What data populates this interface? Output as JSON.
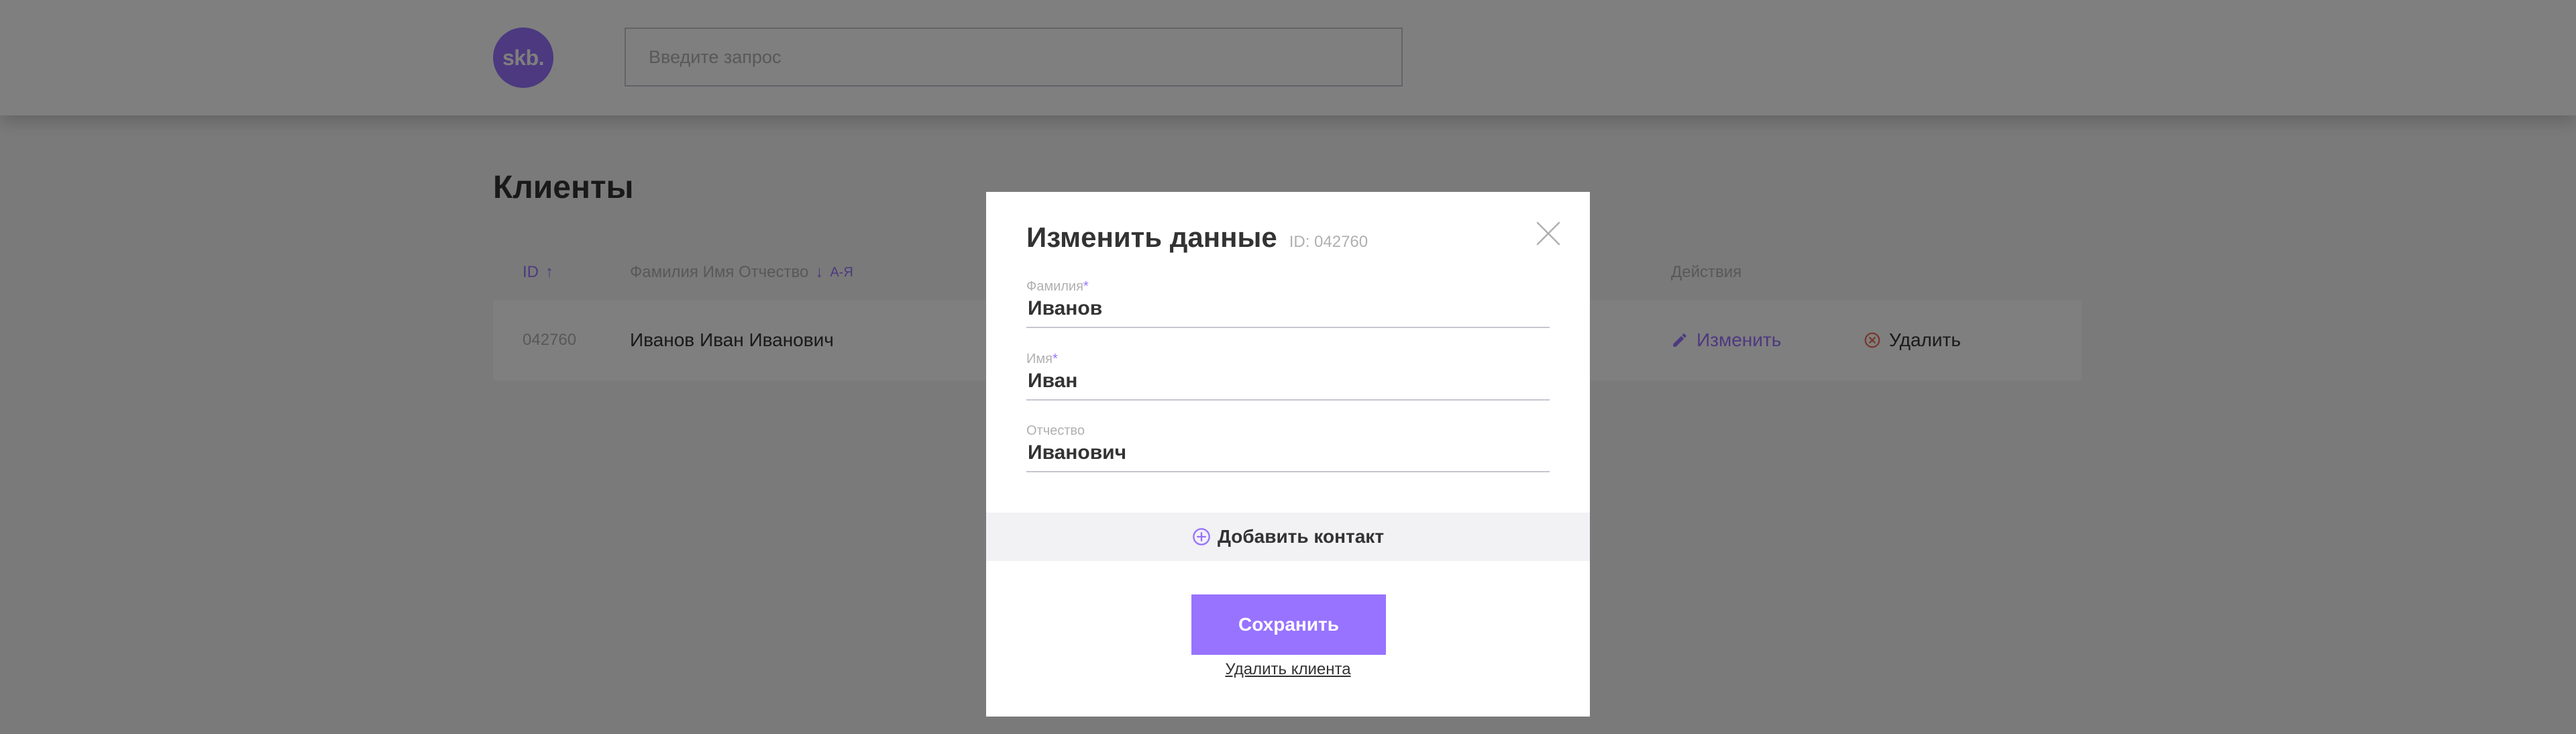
{
  "header": {
    "logo_text": "skb.",
    "search_placeholder": "Введите запрос"
  },
  "page": {
    "title": "Клиенты",
    "table": {
      "headers": {
        "id": "ID",
        "fio": "Фамилия Имя Отчество",
        "fio_sort_hint": "А-Я",
        "actions": "Действия"
      },
      "rows": [
        {
          "id": "042760",
          "fio": "Иванов Иван Иванович",
          "edit_label": "Изменить",
          "delete_label": "Удалить"
        }
      ]
    }
  },
  "modal": {
    "title": "Изменить данные",
    "id_label": "ID: 042760",
    "fields": [
      {
        "label": "Фамилия",
        "required": "*",
        "value": "Иванов"
      },
      {
        "label": "Имя",
        "required": "*",
        "value": "Иван"
      },
      {
        "label": "Отчество",
        "required": "",
        "value": "Иванович"
      }
    ],
    "add_contact_label": "Добавить контакт",
    "save_label": "Сохранить",
    "delete_client_label": "Удалить клиента"
  },
  "colors": {
    "accent": "#9873ff",
    "text": "#333333",
    "muted": "#b0b0b0",
    "danger": "#f06a4d",
    "overlay": "rgba(0,0,0,0.5)"
  },
  "icons": {
    "sort_up": "arrow-up-icon",
    "sort_down": "arrow-down-icon",
    "edit": "pencil-icon",
    "delete": "cancel-circle-icon",
    "close": "close-icon",
    "add_contact": "plus-circle-icon"
  }
}
